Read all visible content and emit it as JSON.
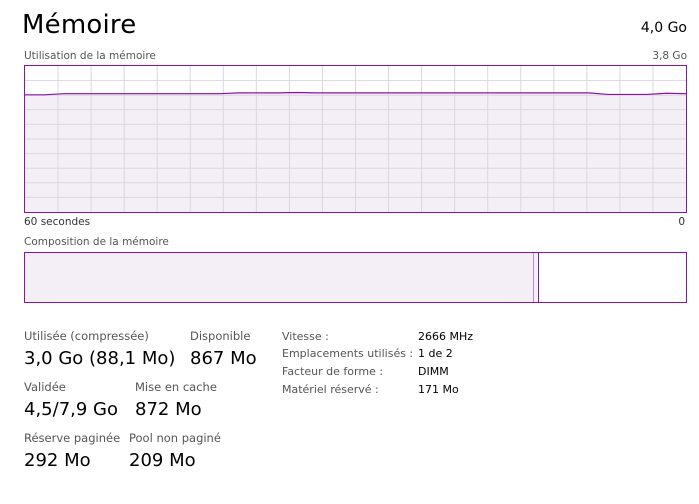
{
  "header": {
    "title": "Mémoire",
    "total": "4,0 Go"
  },
  "graph": {
    "label": "Utilisation de la mémoire",
    "max_label": "3,8 Go",
    "time_left": "60 secondes",
    "time_right": "0",
    "line_color": "#8b12ae",
    "grid_color": "#ddd6e2",
    "max_value": 3.8,
    "usage_series": [
      3.05,
      3.05,
      3.08,
      3.08,
      3.08,
      3.08,
      3.08,
      3.08,
      3.08,
      3.08,
      3.08,
      3.1,
      3.1,
      3.1,
      3.11,
      3.1,
      3.1,
      3.1,
      3.1,
      3.1,
      3.1,
      3.1,
      3.1,
      3.1,
      3.1,
      3.1,
      3.1,
      3.1,
      3.1,
      3.1,
      3.06,
      3.06,
      3.06,
      3.09,
      3.08
    ]
  },
  "composition": {
    "label": "Composition de la mémoire",
    "used_fraction": 0.77,
    "modified_fraction": 0.008,
    "standby_fraction": 0.22,
    "free_fraction": 0.002
  },
  "stats": {
    "used": {
      "label": "Utilisée (compressée)",
      "value": "3,0 Go (88,1 Mo)"
    },
    "available": {
      "label": "Disponible",
      "value": "867 Mo"
    },
    "committed": {
      "label": "Validée",
      "value": "4,5/7,9 Go"
    },
    "cached": {
      "label": "Mise en cache",
      "value": "872 Mo"
    },
    "paged_pool": {
      "label": "Réserve paginée",
      "value": "292 Mo"
    },
    "nonpaged_pool": {
      "label": "Pool non paginé",
      "value": "209 Mo"
    }
  },
  "info": {
    "speed": {
      "label": "Vitesse :",
      "value": "2666 MHz"
    },
    "slots": {
      "label": "Emplacements utilisés :",
      "value": "1 de 2"
    },
    "form_factor": {
      "label": "Facteur de forme :",
      "value": "DIMM"
    },
    "reserved": {
      "label": "Matériel réservé :",
      "value": "171 Mo"
    }
  }
}
